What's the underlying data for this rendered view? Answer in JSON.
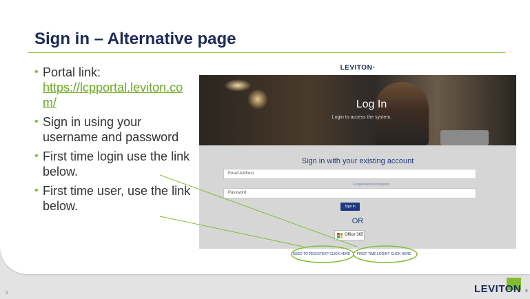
{
  "slide": {
    "title": "Sign in – Alternative page",
    "page_number": "2",
    "logo_text": "LEVITON",
    "logo_registered": "®"
  },
  "bullets": [
    {
      "text": "Portal link:",
      "link": "https://lcpportal.leviton.com/"
    },
    {
      "text": "Sign in using your username and password"
    },
    {
      "text": "First time login use the link below."
    },
    {
      "text": "First time user, use the link below."
    }
  ],
  "screenshot": {
    "brand": "LEVITON",
    "hero_title": "Log In",
    "hero_subtitle": "Login to access the system.",
    "form_title": "Sign in with your existing account",
    "email_placeholder": "Email Address",
    "forgot_label": "Forgot/Reset Password",
    "password_placeholder": "Password",
    "signin_button": "Sign in",
    "or_label": "OR",
    "office_button": "Office 365",
    "register_link": "NEED TO REGISTER? CLICK HERE",
    "first_time_link": "FIRST TIME LOGIN? CLICK HERE"
  },
  "colors": {
    "title": "#1b2a5c",
    "accent_green": "#7fbf2e",
    "link_green": "#6aab1f",
    "form_blue": "#1f3a82"
  }
}
